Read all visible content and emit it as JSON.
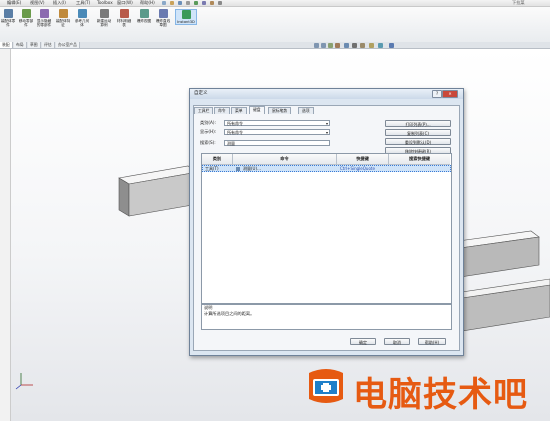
{
  "menubar": {
    "items": [
      "编辑(E)",
      "视图(V)",
      "插入(I)",
      "工具(T)",
      "Toolbox",
      "窗口(W)",
      "帮助(H)"
    ],
    "search_hint": "下拉菜"
  },
  "ribbon": {
    "buttons": [
      {
        "label": "装配体零件",
        "icon": "assembly-icon",
        "color": "#5b7fa6"
      },
      {
        "label": "移动零部件",
        "icon": "move-component-icon",
        "color": "#6a9a4a"
      },
      {
        "label": "显示隐藏的零部件",
        "icon": "show-hidden-icon",
        "color": "#8c6bb0"
      },
      {
        "label": "装配体特征",
        "icon": "assembly-feature-icon",
        "color": "#c08a3c"
      },
      {
        "label": "参考几何体",
        "icon": "reference-geometry-icon",
        "color": "#4a8ab8"
      },
      {
        "label": "新建运动算例",
        "icon": "motion-study-icon",
        "color": "#7a7a7a"
      },
      {
        "label": "材料明细表",
        "icon": "bom-icon",
        "color": "#b85a4a"
      },
      {
        "label": "爆炸视图",
        "icon": "exploded-view-icon",
        "color": "#5a9a8a"
      },
      {
        "label": "爆炸直线草图",
        "icon": "explode-line-icon",
        "color": "#6a7ab0"
      },
      {
        "label": "Instant3D",
        "icon": "instant3d-icon",
        "color": "#3a9a5a"
      }
    ]
  },
  "doc_tabs": [
    "装配",
    "布局",
    "草图",
    "评估",
    "办公室产品"
  ],
  "dialog": {
    "title": "自定义",
    "tabs": [
      "工具栏",
      "命令",
      "菜单",
      "键盘",
      "鼠标笔势",
      "选项"
    ],
    "active_tab": "键盘",
    "category_label": "类别(A):",
    "category_value": "所有命令",
    "show_label": "显示(H):",
    "show_value": "所有命令",
    "search_label": "搜索(S):",
    "search_value": "测量",
    "buttons": {
      "print": "打印列表(P)...",
      "copy": "复制列表(C)",
      "reset": "重设到默认(D)",
      "remove": "移除快捷键(R)",
      "ok": "确定",
      "cancel": "取消",
      "help": "帮助(H)"
    },
    "grid": {
      "headers": [
        "类别",
        "命令",
        "快捷键",
        "搜索快捷键"
      ],
      "rows": [
        {
          "category": "工具(T)",
          "command": "测量(U)...",
          "shortcut": "Ctrl+SingleQuote",
          "search_shortcut": ""
        }
      ]
    },
    "description_label": "说明",
    "description_text": "计算所选项目之间的距离。"
  },
  "watermark": {
    "text": "电脑技术吧",
    "color": "#e65a12"
  },
  "colors": {
    "accent": "#3a7bd5",
    "selection": "#cfe3f8"
  }
}
